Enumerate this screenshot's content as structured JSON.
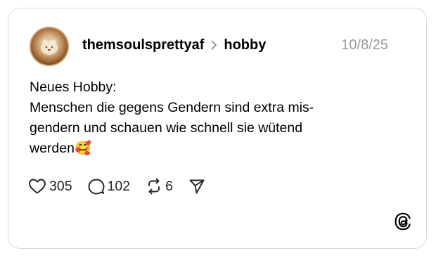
{
  "post": {
    "username": "themsoulsprettyaf",
    "topic": "hobby",
    "date": "10/8/25",
    "lines": [
      "Neues Hobby:",
      "Menschen die gegens Gendern sind extra mis-",
      "gendern und schauen wie schnell sie wütend",
      "werden"
    ],
    "emoji": "🥰"
  },
  "actions": {
    "likes": "305",
    "replies": "102",
    "reposts": "6"
  },
  "icons": {
    "chevron": "chevron-right-icon",
    "like": "heart-icon",
    "reply": "speech-bubble-icon",
    "repost": "repost-icon",
    "share": "send-icon",
    "logo": "threads-logo-icon"
  },
  "colors": {
    "text": "#000000",
    "date": "#999999",
    "border": "#d9d9d9"
  }
}
